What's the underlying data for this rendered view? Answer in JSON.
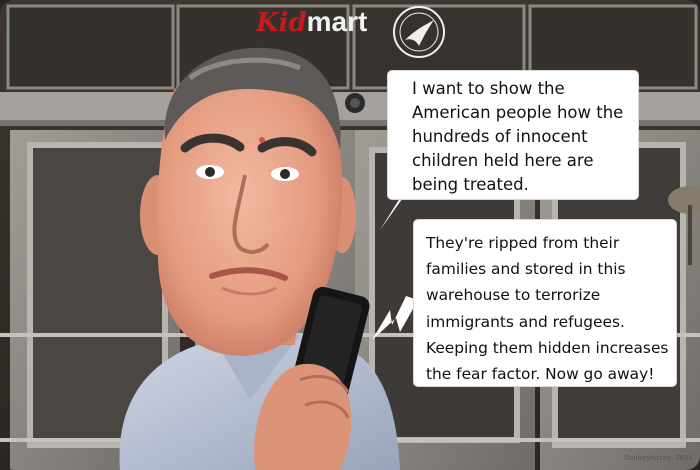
{
  "logo": {
    "part1": "Kid",
    "part2": "mart"
  },
  "bubbles": {
    "top": "I want to show the American people how the hundreds of innocent children held here are being treated.",
    "bottom": "They're ripped from their families and stored in this warehouse to terrorize immigrants and refugees. Keeping them hidden increases the fear factor. Now go away!"
  },
  "signature": "DonkeyHotey 2018",
  "colors": {
    "wall": "#3c342e",
    "glass": "#8c8a86",
    "logo_red": "#c8191e",
    "shirt": "#b9c3d6"
  },
  "icons": {
    "seal": "hhs-eagle-seal",
    "camera": "security-camera-dome"
  }
}
